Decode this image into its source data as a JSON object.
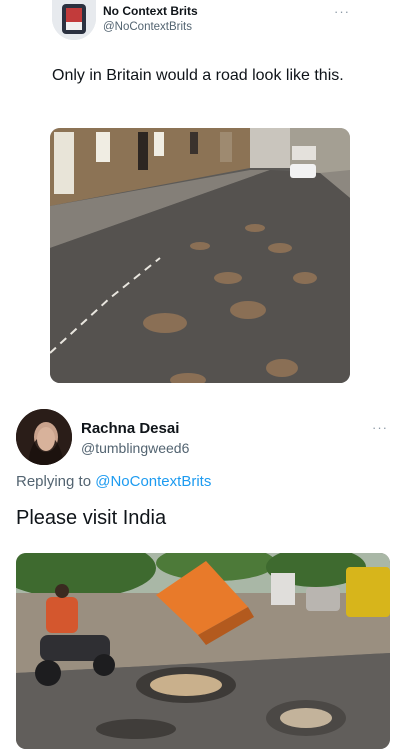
{
  "tweet1": {
    "display_name": "No Context Brits",
    "handle": "@NoContextBrits",
    "more": "···",
    "text": "Only in Britain would a road look like this.",
    "media": "street-with-potholes-photo"
  },
  "tweet2": {
    "display_name": "Rachna Desai",
    "handle": "@tumblingweed6",
    "more": "···",
    "replying_prefix": "Replying to",
    "replying_handle": "@NoContextBrits",
    "text": "Please visit India",
    "media": "damaged-road-with-tipped-truck-photo"
  },
  "colors": {
    "link": "#1d9bf0",
    "secondary_text": "#536471"
  }
}
